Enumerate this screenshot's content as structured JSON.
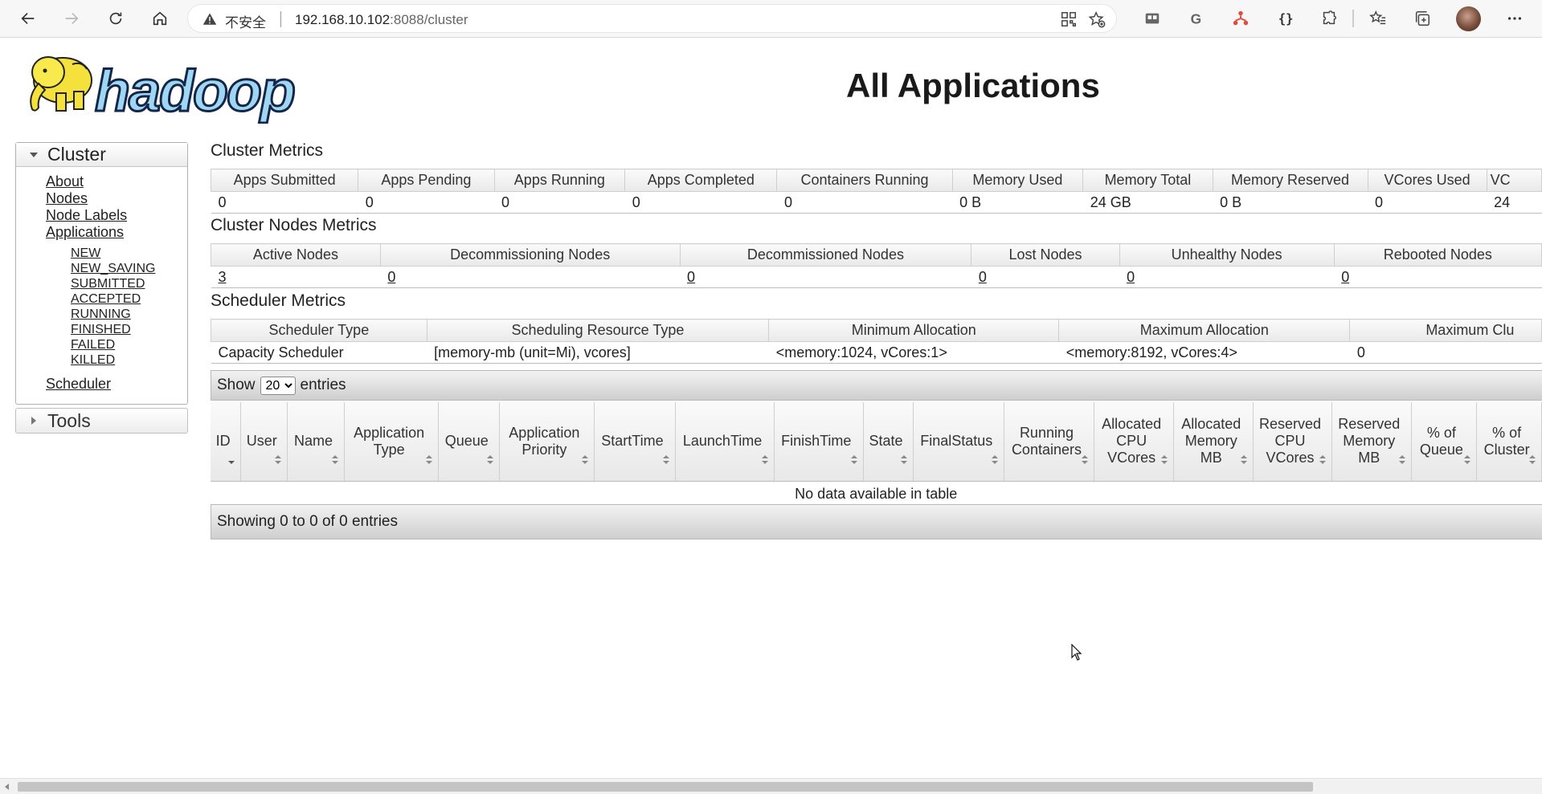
{
  "browser": {
    "security_label": "不安全",
    "url_host": "192.168.10.102",
    "url_rest": ":8088/cluster"
  },
  "page": {
    "title": "All Applications"
  },
  "sidebar": {
    "cluster_header": "Cluster",
    "links": [
      "About",
      "Nodes",
      "Node Labels",
      "Applications"
    ],
    "app_states": [
      "NEW",
      "NEW_SAVING",
      "SUBMITTED",
      "ACCEPTED",
      "RUNNING",
      "FINISHED",
      "FAILED",
      "KILLED"
    ],
    "scheduler": "Scheduler",
    "tools_header": "Tools"
  },
  "cluster_metrics": {
    "title": "Cluster Metrics",
    "headers": [
      "Apps Submitted",
      "Apps Pending",
      "Apps Running",
      "Apps Completed",
      "Containers Running",
      "Memory Used",
      "Memory Total",
      "Memory Reserved",
      "VCores Used",
      "VC"
    ],
    "values": [
      "0",
      "0",
      "0",
      "0",
      "0",
      "0 B",
      "24 GB",
      "0 B",
      "0",
      "24"
    ]
  },
  "nodes_metrics": {
    "title": "Cluster Nodes Metrics",
    "headers": [
      "Active Nodes",
      "Decommissioning Nodes",
      "Decommissioned Nodes",
      "Lost Nodes",
      "Unhealthy Nodes",
      "Rebooted Nodes"
    ],
    "values": [
      "3",
      "0",
      "0",
      "0",
      "0",
      "0"
    ]
  },
  "scheduler_metrics": {
    "title": "Scheduler Metrics",
    "headers": [
      "Scheduler Type",
      "Scheduling Resource Type",
      "Minimum Allocation",
      "Maximum Allocation",
      "Maximum Clu"
    ],
    "values": [
      "Capacity Scheduler",
      "[memory-mb (unit=Mi), vcores]",
      "<memory:1024, vCores:1>",
      "<memory:8192, vCores:4>",
      "0"
    ]
  },
  "apps_table": {
    "show_label": "Show",
    "page_size": "20",
    "entries_label": "entries",
    "columns": [
      "ID",
      "User",
      "Name",
      "Application Type",
      "Queue",
      "Application Priority",
      "StartTime",
      "LaunchTime",
      "FinishTime",
      "State",
      "FinalStatus",
      "Running Containers",
      "Allocated CPU VCores",
      "Allocated Memory MB",
      "Reserved CPU VCores",
      "Reserved Memory MB",
      "% of Queue",
      "% of Cluster"
    ],
    "empty_message": "No data available in table",
    "info": "Showing 0 to 0 of 0 entries"
  }
}
